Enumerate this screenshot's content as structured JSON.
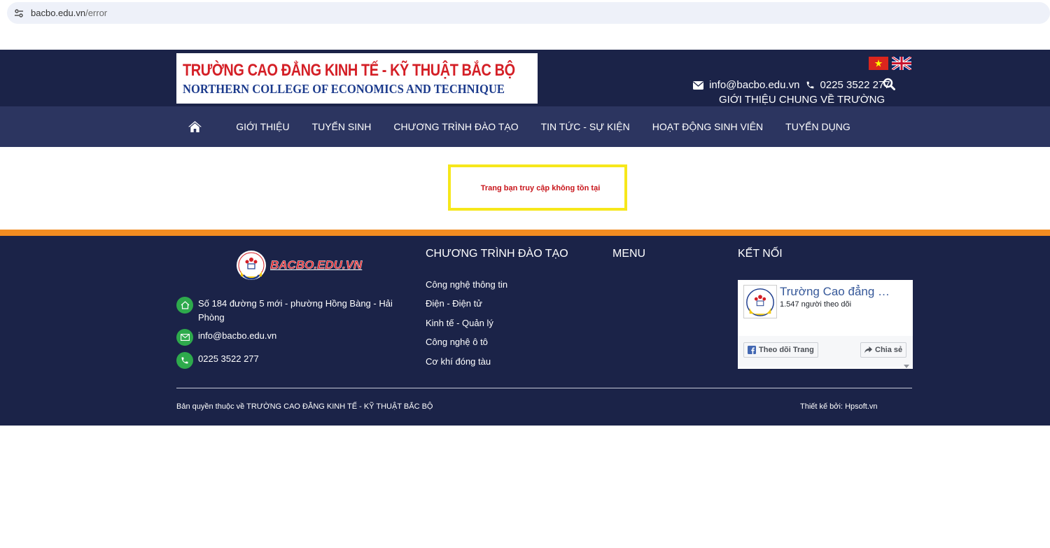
{
  "browser": {
    "url_host": "bacbo.edu.vn",
    "url_path": "/error"
  },
  "header": {
    "logo_vn": "TRƯỜNG CAO ĐẲNG KINH TẾ - KỸ THUẬT BẮC BỘ",
    "logo_en": "NORTHERN COLLEGE OF ECONOMICS AND TECHNIQUE",
    "email": "info@bacbo.edu.vn",
    "phone": "0225 3522 277",
    "intro_link": "GIỚI THIỆU CHUNG VỀ TRƯỜNG"
  },
  "nav": {
    "items": [
      {
        "label": "GIỚI THIỆU"
      },
      {
        "label": "TUYỂN SINH"
      },
      {
        "label": "CHƯƠNG TRÌNH ĐÀO TẠO"
      },
      {
        "label": "TIN TỨC - SỰ KIỆN"
      },
      {
        "label": "HOẠT ĐỘNG SINH VIÊN"
      },
      {
        "label": "TUYỂN DỤNG"
      }
    ]
  },
  "error": {
    "message": "Trang bạn truy cập không tồn tại"
  },
  "footer": {
    "brand": "BACBO.EDU.VN",
    "address": "Số 184 đường 5 mới - phường Hồng Bàng - Hải Phòng",
    "email": "info@bacbo.edu.vn",
    "phone": "0225 3522 277",
    "programs_title": "CHƯƠNG TRÌNH ĐÀO TẠO",
    "programs": [
      "Công nghệ thông tin",
      "Điện - Điện tử",
      "Kinh tế - Quản lý",
      "Công nghệ ô tô",
      "Cơ khí đóng tàu"
    ],
    "menu_title": "MENU",
    "connect_title": "KẾT NỐI",
    "facebook": {
      "page_name": "Trường Cao đẳng …",
      "followers": "1.547 người theo dõi",
      "follow_label": "Theo dõi Trang",
      "share_label": "Chia sẻ"
    },
    "copyright": "Bản quyền thuộc về TRƯỜNG CAO ĐẲNG KINH TẾ - KỸ THUẬT BẮC BỘ",
    "designer": "Thiết kế bởi: Hpsoft.vn"
  },
  "colors": {
    "navy": "#1b2348",
    "nav_bar": "#2c3560",
    "orange": "#f28c21",
    "error_red": "#c8151b",
    "error_border": "#f6e71b",
    "icon_green": "#2eaa4c"
  }
}
